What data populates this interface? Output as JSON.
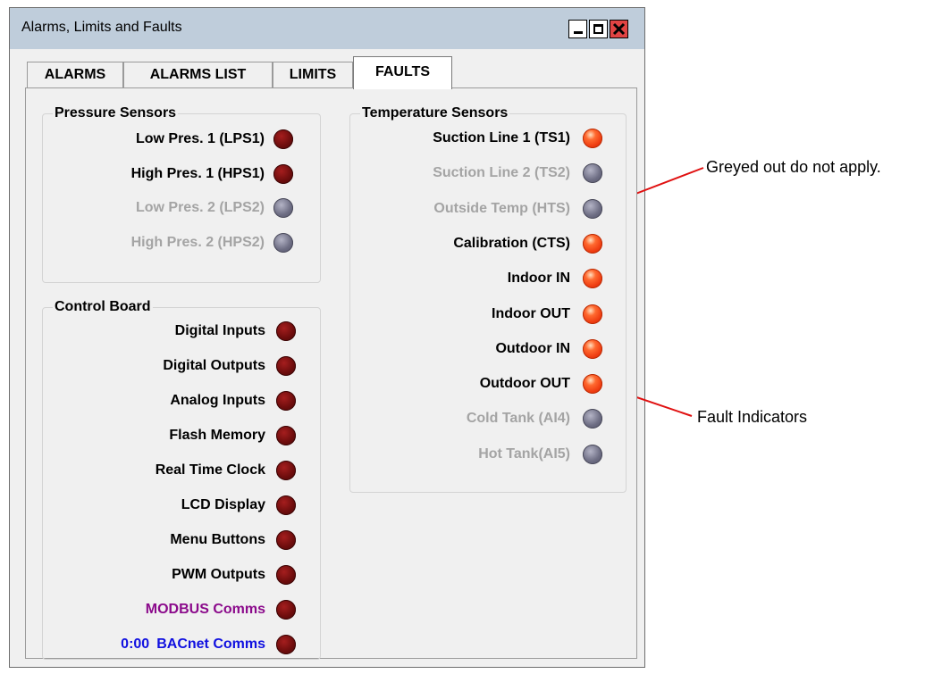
{
  "window": {
    "title": "Alarms, Limits and Faults",
    "controls": [
      "minimize",
      "maximize",
      "close"
    ]
  },
  "tabs": [
    {
      "label": "ALARMS",
      "active": false
    },
    {
      "label": "ALARMS LIST",
      "active": false
    },
    {
      "label": "LIMITS",
      "active": false
    },
    {
      "label": "FAULTS",
      "active": true
    }
  ],
  "pressure_sensors": {
    "title": "Pressure Sensors",
    "items": [
      {
        "label": "Low Pres. 1 (LPS1)",
        "state": "dark-red"
      },
      {
        "label": "High Pres. 1 (HPS1)",
        "state": "dark-red"
      },
      {
        "label": "Low Pres. 2 (LPS2)",
        "state": "disabled"
      },
      {
        "label": "High Pres. 2 (HPS2)",
        "state": "disabled"
      }
    ]
  },
  "control_board": {
    "title": "Control Board",
    "items": [
      {
        "label": "Digital Inputs",
        "state": "dark-red"
      },
      {
        "label": "Digital Outputs",
        "state": "dark-red"
      },
      {
        "label": "Analog Inputs",
        "state": "dark-red"
      },
      {
        "label": "Flash Memory",
        "state": "dark-red"
      },
      {
        "label": "Real Time Clock",
        "state": "dark-red"
      },
      {
        "label": "LCD Display",
        "state": "dark-red"
      },
      {
        "label": "Menu Buttons",
        "state": "dark-red"
      },
      {
        "label": "PWM Outputs",
        "state": "dark-red"
      },
      {
        "label": "MODBUS Comms",
        "state": "dark-red",
        "color": "#8b0a8b"
      },
      {
        "label": "BACnet Comms",
        "prefix": "0:00",
        "state": "dark-red",
        "color": "#1010e0"
      }
    ]
  },
  "temperature_sensors": {
    "title": "Temperature Sensors",
    "items": [
      {
        "label": "Suction Line 1 (TS1)",
        "state": "fault"
      },
      {
        "label": "Suction Line 2 (TS2)",
        "state": "disabled"
      },
      {
        "label": "Outside Temp (HTS)",
        "state": "disabled"
      },
      {
        "label": "Calibration (CTS)",
        "state": "fault"
      },
      {
        "label": "Indoor IN",
        "state": "fault"
      },
      {
        "label": "Indoor OUT",
        "state": "fault"
      },
      {
        "label": "Outdoor IN",
        "state": "fault"
      },
      {
        "label": "Outdoor OUT",
        "state": "fault"
      },
      {
        "label": "Cold Tank (AI4)",
        "state": "disabled"
      },
      {
        "label": "Hot Tank(AI5)",
        "state": "disabled"
      }
    ]
  },
  "annotations": {
    "greyed": "Greyed out do not apply.",
    "fault": "Fault Indicators"
  },
  "colors": {
    "titlebar": "#bfcddb",
    "close_button": "#e04343",
    "fault_led": "#ee3b10",
    "dark_led": "#6e0d0d",
    "disabled_led": "#6e6e84",
    "disabled_text": "#a4a4a4",
    "arrow": "#e01010"
  }
}
